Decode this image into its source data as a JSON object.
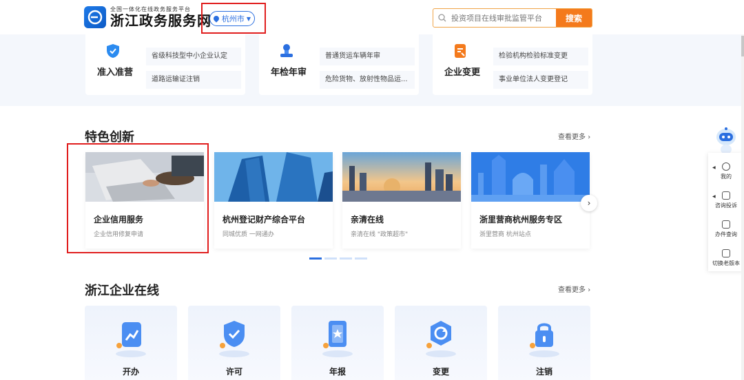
{
  "header": {
    "logo_sub": "全国一体化在线政务服务平台",
    "logo_main": "浙江政务服务网",
    "city": "杭州市",
    "search_placeholder": "投资项目在线审批监管平台",
    "search_button": "搜索"
  },
  "services": [
    {
      "title": "准入准营",
      "icon": "shield-check-icon",
      "items": [
        "省级科技型中小企业认定",
        "道路运输证注销"
      ]
    },
    {
      "title": "年检年审",
      "icon": "stamp-icon",
      "items": [
        "普通货运车辆年审",
        "危险货物、放射性物品运..."
      ]
    },
    {
      "title": "企业变更",
      "icon": "document-change-icon",
      "items": [
        "检验机构检验标准变更",
        "事业单位法人变更登记"
      ]
    }
  ],
  "featured": {
    "title": "特色创新",
    "more": "查看更多",
    "cards": [
      {
        "title": "企业信用服务",
        "subtitle": "企业信用修复申请"
      },
      {
        "title": "杭州登记财产综合平台",
        "subtitle": "同城优质 一网通办"
      },
      {
        "title": "亲清在线",
        "subtitle": "亲清在线 \"政策超市\""
      },
      {
        "title": "浙里营商杭州服务专区",
        "subtitle": "浙里营商 杭州站点"
      }
    ],
    "active_page": 1,
    "page_count": 4
  },
  "enterprise": {
    "title": "浙江企业在线",
    "more": "查看更多",
    "cards": [
      {
        "label": "开办",
        "icon": "chart-up-icon"
      },
      {
        "label": "许可",
        "icon": "shield-check-icon"
      },
      {
        "label": "年报",
        "icon": "report-star-icon"
      },
      {
        "label": "变更",
        "icon": "refresh-icon"
      },
      {
        "label": "注销",
        "icon": "lock-icon"
      }
    ]
  },
  "float_bar": {
    "items": [
      "我的",
      "咨询投诉",
      "办件查询",
      "切换老版本"
    ]
  },
  "colors": {
    "brand_blue": "#2b6fe0",
    "search_orange": "#f47a1c",
    "highlight_red": "#e01d1d"
  }
}
